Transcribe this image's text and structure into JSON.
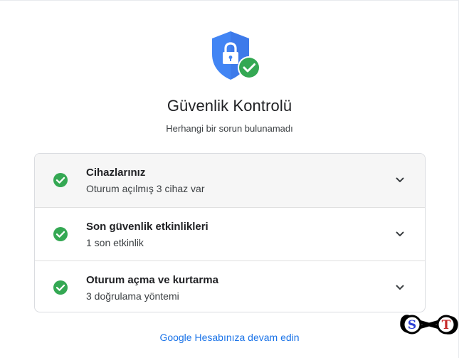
{
  "header": {
    "title": "Güvenlik Kontrolü",
    "subtitle": "Herhangi bir sorun bulunamadı"
  },
  "hero_icon": "shield-lock-with-check-icon",
  "colors": {
    "shield_blue": "#4285f4",
    "check_green": "#34a853",
    "link_blue": "#1a73e8",
    "border": "#dadce0"
  },
  "items": [
    {
      "title": "Cihazlarınız",
      "subtitle": "Oturum açılmış 3 cihaz var",
      "status_icon": "check-circle-icon",
      "action_icon": "chevron-down-icon"
    },
    {
      "title": "Son güvenlik etkinlikleri",
      "subtitle": "1 son etkinlik",
      "status_icon": "check-circle-icon",
      "action_icon": "chevron-down-icon"
    },
    {
      "title": "Oturum açma ve kurtarma",
      "subtitle": "3 doğrulama yöntemi",
      "status_icon": "check-circle-icon",
      "action_icon": "chevron-down-icon"
    }
  ],
  "footer": {
    "continue_label": "Google Hesabınıza devam edin"
  },
  "watermark": {
    "letters": [
      "S",
      "T"
    ]
  }
}
